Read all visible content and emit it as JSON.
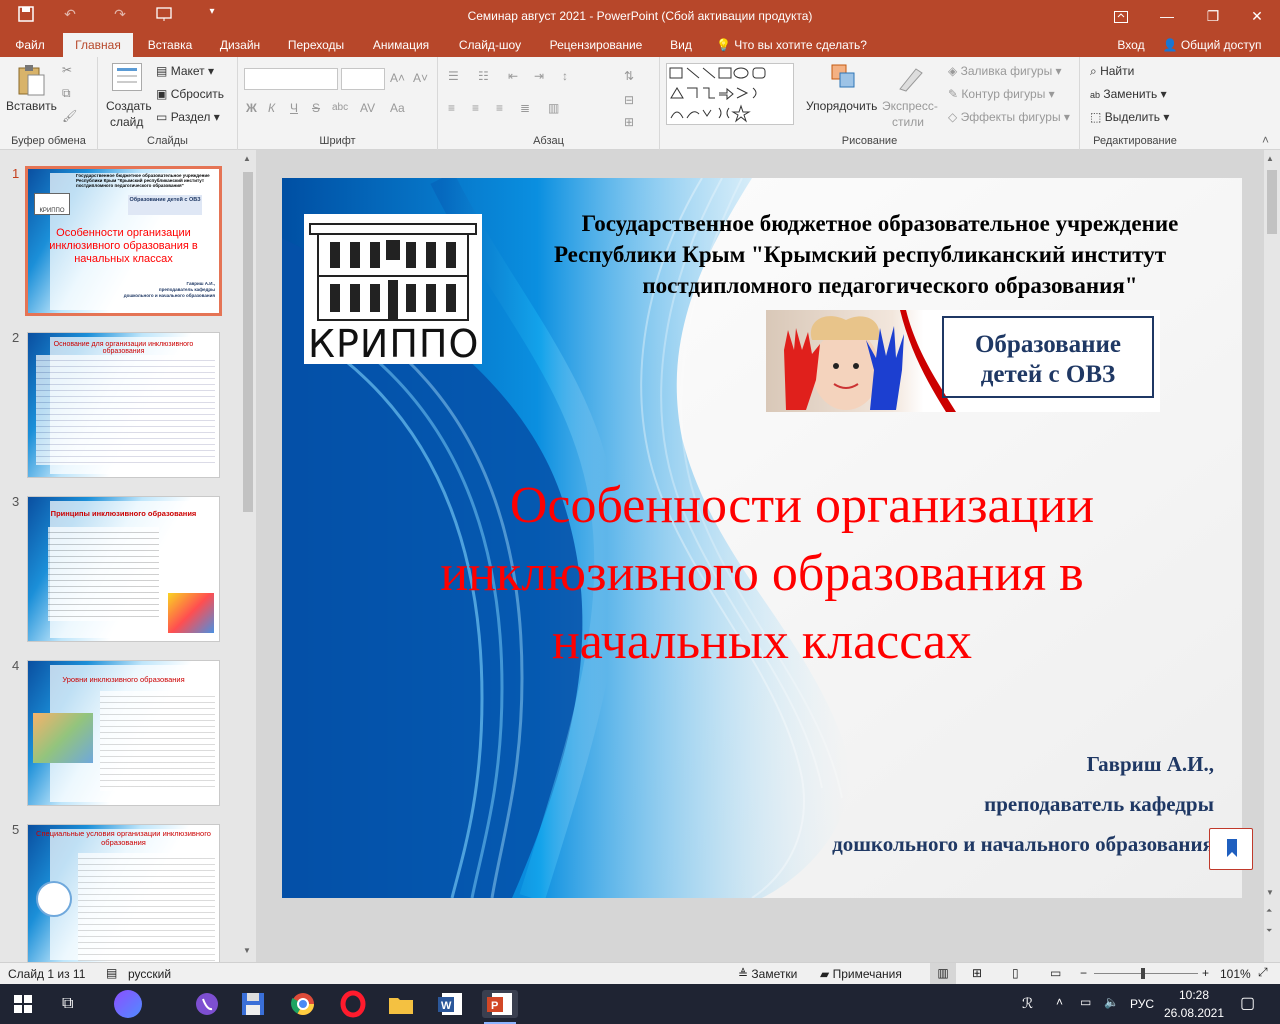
{
  "window": {
    "title": "Семинар август 2021 - PowerPoint (Сбой активации продукта)"
  },
  "tabs": [
    "Файл",
    "Главная",
    "Вставка",
    "Дизайн",
    "Переходы",
    "Анимация",
    "Слайд-шоу",
    "Рецензирование",
    "Вид"
  ],
  "tell_me": "Что вы хотите сделать?",
  "signin": "Вход",
  "share": "Общий доступ",
  "ribbon": {
    "clipboard": {
      "paste": "Вставить",
      "label": "Буфер обмена"
    },
    "slides": {
      "new_slide": "Создать",
      "new_slide2": "слайд",
      "layout": "Макет",
      "reset": "Сбросить",
      "section": "Раздел",
      "label": "Слайды"
    },
    "font": {
      "label": "Шрифт",
      "bold": "Ж",
      "italic": "К",
      "underline": "Ч",
      "strike": "S",
      "shadow": "abc",
      "spacing": "AV",
      "case": "Aa"
    },
    "paragraph": {
      "label": "Абзац"
    },
    "drawing": {
      "arrange": "Упорядочить",
      "quick1": "Экспресс-",
      "quick2": "стили",
      "fill": "Заливка фигуры",
      "outline": "Контур фигуры",
      "effects": "Эффекты фигуры",
      "label": "Рисование"
    },
    "editing": {
      "find": "Найти",
      "replace": "Заменить",
      "select": "Выделить",
      "label": "Редактирование"
    }
  },
  "thumbs": [
    {
      "num": "1",
      "title": "Особенности организации инклюзивного образования в начальных классах",
      "header": "Государственное бюджетное образовательное учреждение Республики Крым \"Крымский республиканский институт постдипломного педагогического образования\"",
      "logo": "КРИППО",
      "badge": "Образование детей с ОВЗ",
      "author": "Гавриш А.И.,",
      "role": "преподаватель кафедры",
      "dept": "дошкольного и начального образования"
    },
    {
      "num": "2",
      "title": "Основание для организации инклюзивного образования"
    },
    {
      "num": "3",
      "title": "Принципы инклюзивного образования"
    },
    {
      "num": "4",
      "title": "Уровни инклюзивного образования"
    },
    {
      "num": "5",
      "title": "Специальные условия организации инклюзивного образования"
    }
  ],
  "slide": {
    "header1": "Государственное бюджетное образовательное учреждение",
    "header2": "Республики Крым \"Крымский республиканский институт",
    "header3": "постдипломного педагогического образования\"",
    "logo": "КРИППО",
    "badge1": "Образование",
    "badge2": "детей с ОВЗ",
    "title1": "Особенности организации",
    "title2": "инклюзивного образования в",
    "title3": "начальных классах",
    "author": "Гавриш А.И.,",
    "role": "преподаватель кафедры",
    "dept": "дошкольного и начального образования"
  },
  "status": {
    "slide": "Слайд 1 из 11",
    "lang": "русский",
    "notes": "Заметки",
    "comments": "Примечания",
    "zoom": "101%"
  },
  "tray": {
    "lang": "РУС",
    "time": "10:28",
    "date": "26.08.2021"
  },
  "colors": {
    "accent": "#b7472a",
    "title_red": "#ff0000",
    "navy": "#1f3864"
  }
}
